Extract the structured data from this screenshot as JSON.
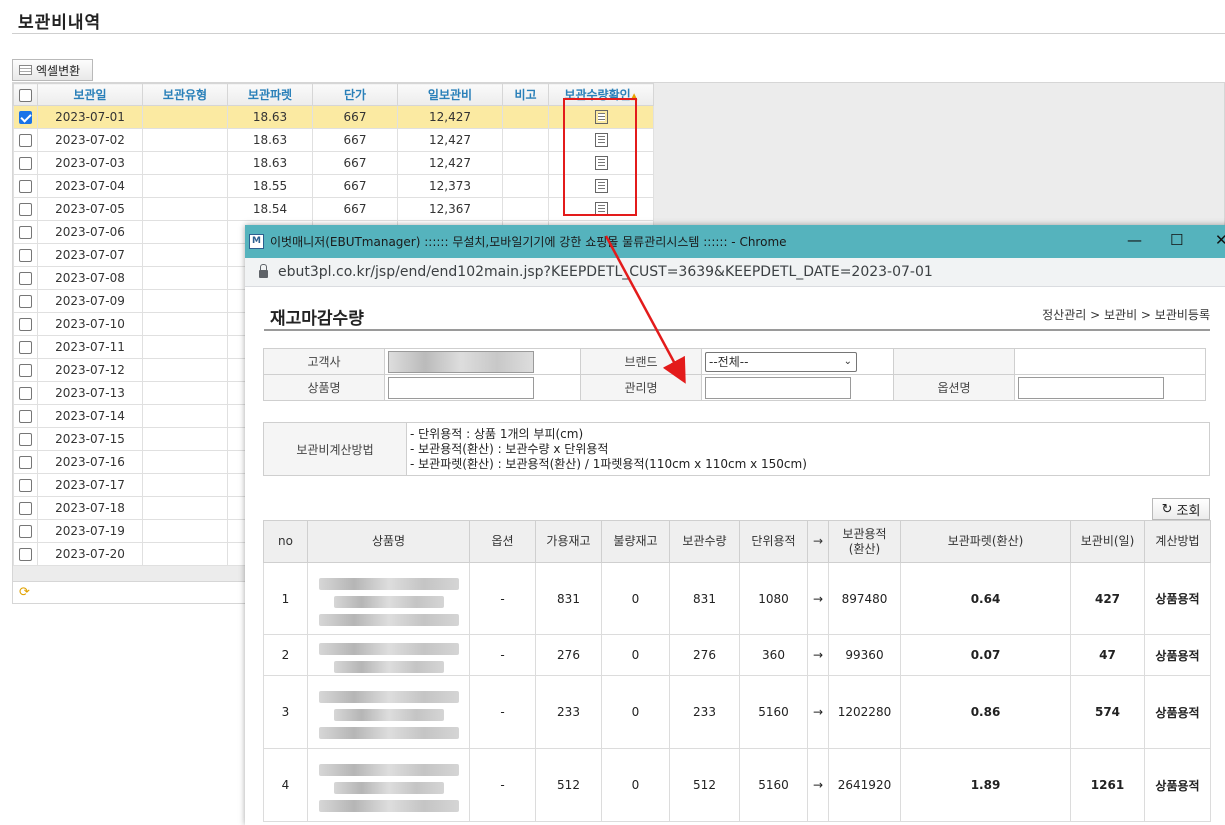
{
  "page": {
    "title": "보관비내역"
  },
  "toolbar": {
    "excel_label": "엑셀변환"
  },
  "grid": {
    "headers": [
      "보관일",
      "보관유형",
      "보관파렛",
      "단가",
      "일보관비",
      "비고",
      "보관수량확인"
    ],
    "rows": [
      {
        "date": "2023-07-01",
        "type": "",
        "pallet": "18.63",
        "price": "667",
        "fee": "12,427",
        "note": "",
        "checked": true
      },
      {
        "date": "2023-07-02",
        "type": "",
        "pallet": "18.63",
        "price": "667",
        "fee": "12,427",
        "note": ""
      },
      {
        "date": "2023-07-03",
        "type": "",
        "pallet": "18.63",
        "price": "667",
        "fee": "12,427",
        "note": ""
      },
      {
        "date": "2023-07-04",
        "type": "",
        "pallet": "18.55",
        "price": "667",
        "fee": "12,373",
        "note": ""
      },
      {
        "date": "2023-07-05",
        "type": "",
        "pallet": "18.54",
        "price": "667",
        "fee": "12,367",
        "note": ""
      },
      {
        "date": "2023-07-06"
      },
      {
        "date": "2023-07-07"
      },
      {
        "date": "2023-07-08"
      },
      {
        "date": "2023-07-09"
      },
      {
        "date": "2023-07-10"
      },
      {
        "date": "2023-07-11"
      },
      {
        "date": "2023-07-12"
      },
      {
        "date": "2023-07-13"
      },
      {
        "date": "2023-07-14"
      },
      {
        "date": "2023-07-15"
      },
      {
        "date": "2023-07-16"
      },
      {
        "date": "2023-07-17"
      },
      {
        "date": "2023-07-18"
      },
      {
        "date": "2023-07-19"
      },
      {
        "date": "2023-07-20"
      }
    ]
  },
  "popup": {
    "window_title": "이벗매니저(EBUTmanager) :::::: 무설치,모바일기기에 강한 쇼핑몰 물류관리시스템 :::::: - Chrome",
    "url": "ebut3pl.co.kr/jsp/end/end102main.jsp?KEEPDETL_CUST=3639&KEEPDETL_DATE=2023-07-01",
    "title": "재고마감수량",
    "breadcrumb": "정산관리 > 보관비 > 보관비등록",
    "filter": {
      "customer_label": "고객사",
      "brand_label": "브랜드",
      "brand_value": "--전체--",
      "product_label": "상품명",
      "manage_label": "관리명",
      "option_label": "옵션명"
    },
    "method": {
      "label": "보관비계산방법",
      "lines": [
        "- 단위용적 : 상품 1개의 부피(cm)",
        "- 보관용적(환산) : 보관수량 x 단위용적",
        "- 보관파렛(환산) : 보관용적(환산) / 1파렛용적(110cm x 110cm x 150cm)"
      ]
    },
    "query_label": "조회",
    "table": {
      "headers": [
        "no",
        "상품명",
        "옵션",
        "가용재고",
        "불량재고",
        "보관수량",
        "단위용적",
        "→",
        "보관용적\n(환산)",
        "보관파렛(환산)",
        "보관비(일)",
        "계산방법"
      ],
      "rows": [
        {
          "no": "1",
          "option": "-",
          "avail": "831",
          "bad": "0",
          "qty": "831",
          "unit": "1080",
          "arrow": "→",
          "vol": "897480",
          "pallet": "0.64",
          "fee": "427",
          "method": "상품용적"
        },
        {
          "no": "2",
          "option": "-",
          "avail": "276",
          "bad": "0",
          "qty": "276",
          "unit": "360",
          "arrow": "→",
          "vol": "99360",
          "pallet": "0.07",
          "fee": "47",
          "method": "상품용적"
        },
        {
          "no": "3",
          "option": "-",
          "avail": "233",
          "bad": "0",
          "qty": "233",
          "unit": "5160",
          "arrow": "→",
          "vol": "1202280",
          "pallet": "0.86",
          "fee": "574",
          "method": "상품용적"
        },
        {
          "no": "4",
          "option": "-",
          "avail": "512",
          "bad": "0",
          "qty": "512",
          "unit": "5160",
          "arrow": "→",
          "vol": "2641920",
          "pallet": "1.89",
          "fee": "1261",
          "method": "상품용적"
        }
      ]
    }
  },
  "colors": {
    "annotation_red": "#e31b1b",
    "titlebar": "#55b3bd",
    "selected_row": "#fbeaa2",
    "header_text": "#2a80b9"
  }
}
